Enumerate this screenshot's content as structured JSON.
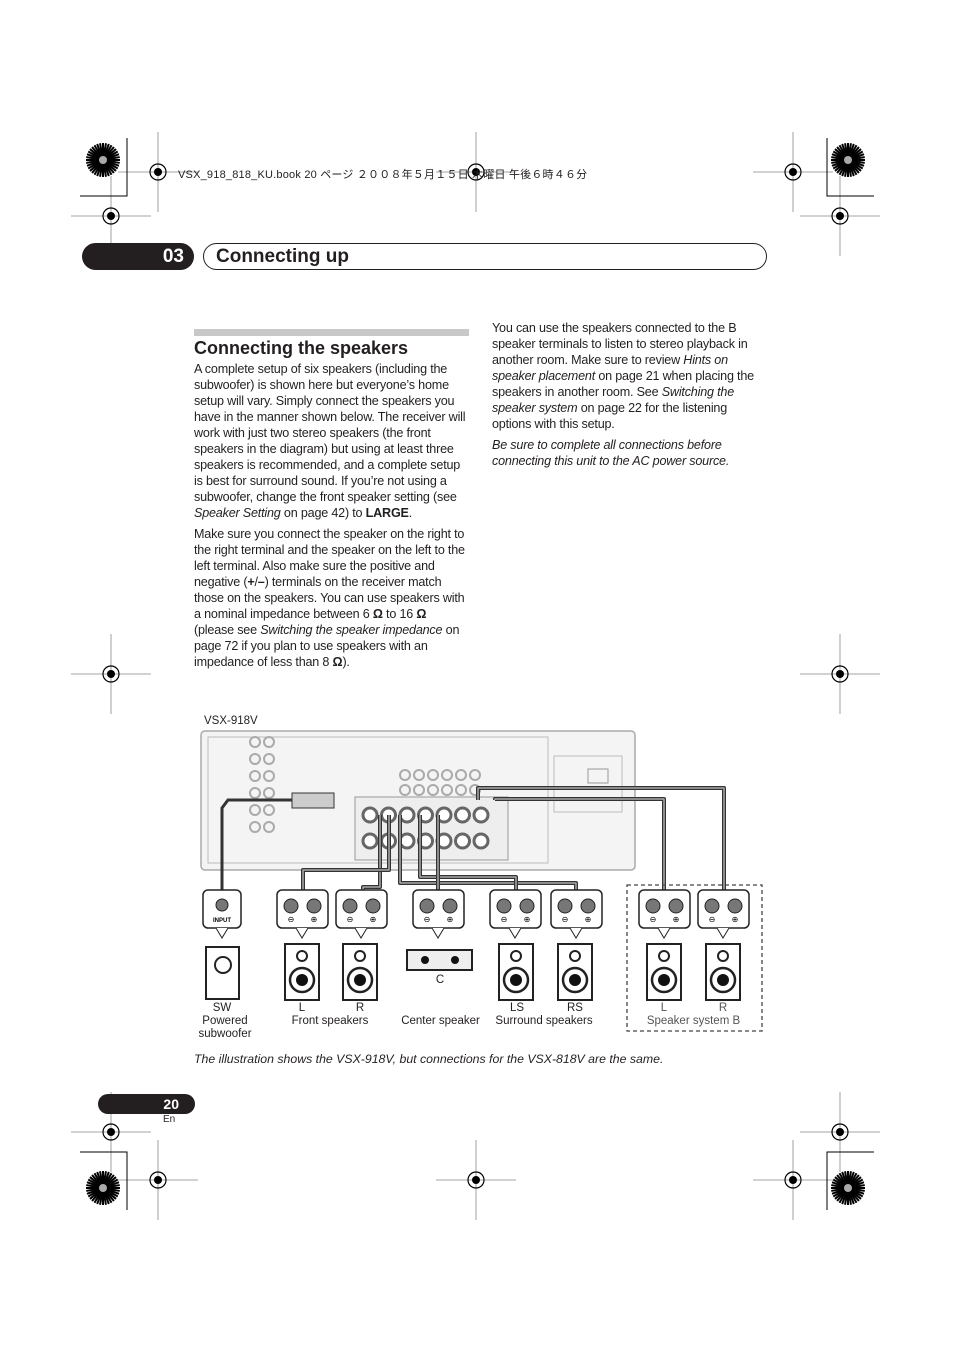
{
  "running_header": "VSX_918_818_KU.book  20 ページ  ２００８年５月１５日  木曜日  午後６時４６分",
  "chapter": {
    "number": "03",
    "title": "Connecting up"
  },
  "section_title": "Connecting the speakers",
  "left_column": [
    [
      {
        "t": "A complete setup of six speakers (including the subwoofer) is shown here but everyone’s home setup will vary. Simply connect the speakers you have in the manner shown below. The receiver will work with just two stereo speakers (the front speakers in the diagram) but using at least three speakers is recommended, and a complete setup is best for surround sound. If you’re not using a subwoofer, change the front speaker setting (see "
      },
      {
        "t": "Speaker Setting",
        "s": "i"
      },
      {
        "t": " on page 42) to "
      },
      {
        "t": "LARGE",
        "s": "b"
      },
      {
        "t": "."
      }
    ],
    [
      {
        "t": "Make sure you connect the speaker on the right to the right terminal and the speaker on the left to the left terminal. Also make sure the positive and negative ("
      },
      {
        "t": "+",
        "s": "b"
      },
      {
        "t": "/"
      },
      {
        "t": "–",
        "s": "b"
      },
      {
        "t": ") terminals on the receiver match those on the speakers. You can use speakers with a nominal impedance between 6 "
      },
      {
        "t": "Ω",
        "s": "b"
      },
      {
        "t": " to 16 "
      },
      {
        "t": "Ω",
        "s": "b"
      },
      {
        "t": " (please see "
      },
      {
        "t": "Switching the speaker impedance",
        "s": "i"
      },
      {
        "t": " on page 72 if you plan to use speakers with an impedance of less than 8 "
      },
      {
        "t": "Ω",
        "s": "b"
      },
      {
        "t": ")."
      }
    ]
  ],
  "right_column": [
    [
      {
        "t": "You can use the speakers connected to the B speaker terminals to listen to stereo playback in another room. Make sure to review "
      },
      {
        "t": "Hints on speaker placement",
        "s": "i"
      },
      {
        "t": " on page 21 when placing the speakers in another room. See "
      },
      {
        "t": "Switching the speaker system",
        "s": "i"
      },
      {
        "t": " on page 22 for the listening options with this setup."
      }
    ],
    [
      {
        "t": "Be sure to complete all connections before connecting this unit to the AC power source.",
        "s": "i"
      }
    ]
  ],
  "diagram": {
    "model": "VSX-918V",
    "sw_input": "INPUT",
    "labels": {
      "sw": "SW",
      "sw_name": "Powered subwoofer",
      "front_l": "L",
      "front_r": "R",
      "front": "Front speakers",
      "c": "C",
      "center": "Center speaker",
      "ls": "LS",
      "rs": "RS",
      "surround": "Surround speakers",
      "b_l": "L",
      "b_r": "R",
      "speaker_b": "Speaker system B"
    }
  },
  "caption": "The illustration shows the VSX-918V, but connections for the VSX-818V are the same.",
  "page_number": "20",
  "language": "En"
}
